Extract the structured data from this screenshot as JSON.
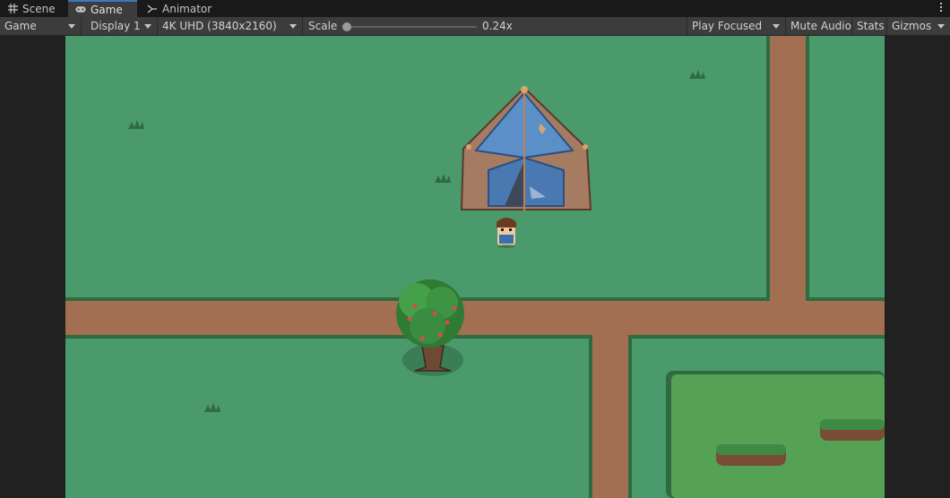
{
  "tabs": [
    {
      "label": "Scene",
      "icon": "grid-icon"
    },
    {
      "label": "Game",
      "icon": "gamepad-icon",
      "active": true
    },
    {
      "label": "Animator",
      "icon": "animator-icon"
    }
  ],
  "toolbar": {
    "view_mode": "Game",
    "display": "Display 1",
    "resolution": "4K UHD (3840x2160)",
    "scale_label": "Scale",
    "scale_value": "0.24x",
    "scale_fraction": 0.0,
    "play_focused": "Play Focused",
    "mute_audio": "Mute Audio",
    "stats": "Stats",
    "gizmos": "Gizmos"
  },
  "colors": {
    "grass": "#4b9a6c",
    "grass_edge": "#2f6b3f",
    "path": "#a36f52",
    "tent_blue": "#5b8fc8",
    "tent_frame": "#a57b62",
    "tab_accent": "#3a79bb"
  }
}
